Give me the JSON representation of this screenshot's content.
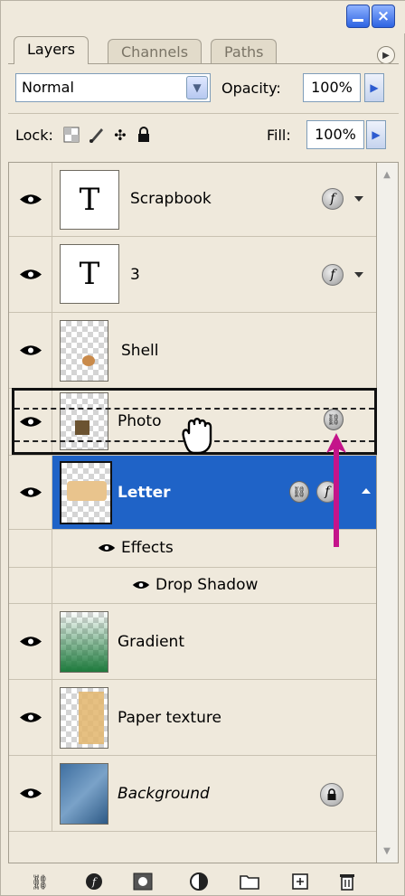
{
  "window": {
    "buttons": [
      {
        "name": "minimize-button"
      },
      {
        "name": "close-button"
      }
    ]
  },
  "tabs": [
    {
      "label": "Layers",
      "active": true
    },
    {
      "label": "Channels",
      "active": false
    },
    {
      "label": "Paths",
      "active": false
    }
  ],
  "blend": {
    "mode": "Normal",
    "opacity_label": "Opacity:",
    "opacity_value": "100%"
  },
  "lock_row": {
    "lock_label": "Lock:",
    "fill_label": "Fill:",
    "fill_value": "100%"
  },
  "layers": [
    {
      "name": "Scrapbook",
      "kind": "text",
      "thumb_char": "T"
    },
    {
      "name": "3",
      "kind": "text",
      "thumb_char": "T"
    },
    {
      "name": "Shell",
      "kind": "image"
    },
    {
      "name": "Photo",
      "kind": "image",
      "dragging": true
    },
    {
      "name": "Letter",
      "kind": "image",
      "selected": true
    },
    {
      "name": "Effects",
      "kind": "effects-group"
    },
    {
      "name": "Drop Shadow",
      "kind": "effect"
    },
    {
      "name": "Gradient",
      "kind": "image"
    },
    {
      "name": "Paper texture",
      "kind": "image"
    },
    {
      "name": "Background",
      "kind": "image",
      "locked": true
    }
  ],
  "colors": {
    "selection": "#1f63c7",
    "panel": "#efe9dc",
    "arrow": "#c4148a"
  }
}
